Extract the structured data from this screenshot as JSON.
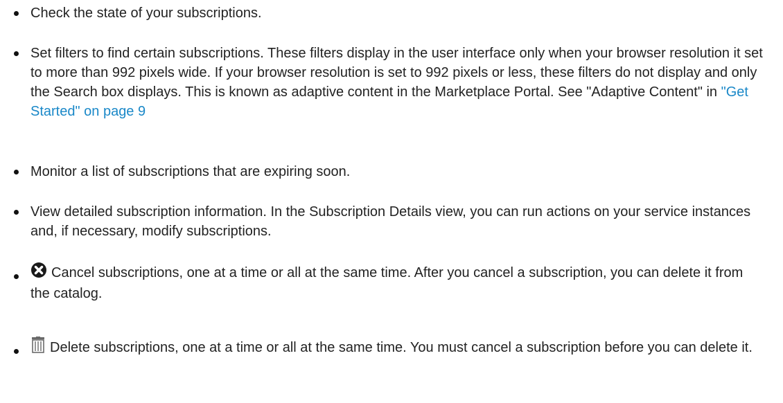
{
  "bullets": {
    "item1": "Check the state of your subscriptions.",
    "item2_text": "Set filters to find certain subscriptions. These filters display in the user interface only when your browser resolution it set to more than 992 pixels wide. If your browser resolution is set to 992 pixels or less, these filters do not display and only the Search box displays. This is known as adaptive content in the Marketplace Portal. See \"Adaptive Content\" in ",
    "item2_link": "\"Get Started\" on page 9",
    "item3": "Monitor a list of subscriptions that are expiring soon.",
    "item4": "View detailed subscription information. In the Subscription Details view, you can run actions on your service instances and, if necessary, modify subscriptions.",
    "item5": "Cancel subscriptions, one at a time or all at the same time. After you cancel a subscription, you can delete it from the catalog.",
    "item6": "Delete subscriptions, one at a time or all at the same time. You must cancel a subscription before you can delete it."
  },
  "icons": {
    "cancel": "cancel-circle-x-icon",
    "delete": "trash-can-icon"
  },
  "colors": {
    "text": "#222222",
    "link": "#1a88c8"
  }
}
